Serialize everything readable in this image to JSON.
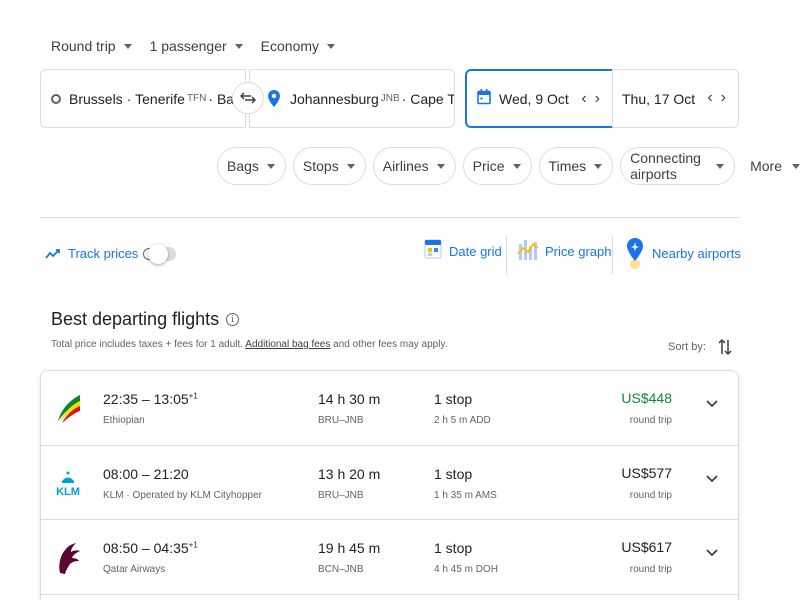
{
  "search": {
    "trip_type": "Round trip",
    "passengers": "1 passenger",
    "cabin": "Economy",
    "origin": {
      "city1": "Brussels",
      "city2": "Tenerife",
      "code2": "TFN",
      "city3": "Barcel…"
    },
    "destination": {
      "city1": "Johannesburg",
      "code1": "JNB",
      "city2": "Cape Tow…"
    },
    "depart_date": "Wed, 9 Oct",
    "return_date": "Thu, 17 Oct"
  },
  "filters": [
    "Bags",
    "Stops",
    "Airlines",
    "Price",
    "Times",
    "Connecting airports"
  ],
  "more_label": "More",
  "tools": {
    "track_prices": "Track prices",
    "date_grid": "Date grid",
    "price_graph": "Price graph",
    "nearby_airports": "Nearby airports"
  },
  "results": {
    "title": "Best departing flights",
    "subtitle_pre": "Total price includes taxes + fees for 1 adult.",
    "subtitle_link": "Additional bag fees",
    "subtitle_post": "and other fees may apply.",
    "sort_by": "Sort by:",
    "flights": [
      {
        "depart": "22:35",
        "arrive": "13:05",
        "plus_days": "+1",
        "airline": "Ethiopian",
        "duration": "14 h 30 m",
        "route": "BRU–JNB",
        "stops": "1 stop",
        "layover": "2 h 5 m ADD",
        "price": "US$448",
        "price_type": "round trip",
        "logo": "ethiopian-logo"
      },
      {
        "depart": "08:00",
        "arrive": "21:20",
        "plus_days": "",
        "airline": "KLM · Operated by KLM Cityhopper",
        "duration": "13 h 20 m",
        "route": "BRU–JNB",
        "stops": "1 stop",
        "layover": "1 h 35 m AMS",
        "price": "US$577",
        "price_type": "round trip",
        "logo": "klm-logo"
      },
      {
        "depart": "08:50",
        "arrive": "04:35",
        "plus_days": "+1",
        "airline": "Qatar Airways",
        "duration": "19 h 45 m",
        "route": "BCN–JNB",
        "stops": "1 stop",
        "layover": "4 h 45 m DOH",
        "price": "US$617",
        "price_type": "round trip",
        "logo": "qatar-logo"
      }
    ]
  },
  "colors": {
    "accent": "#1a73e8",
    "good_price": "#188038",
    "border": "#dadce0"
  }
}
